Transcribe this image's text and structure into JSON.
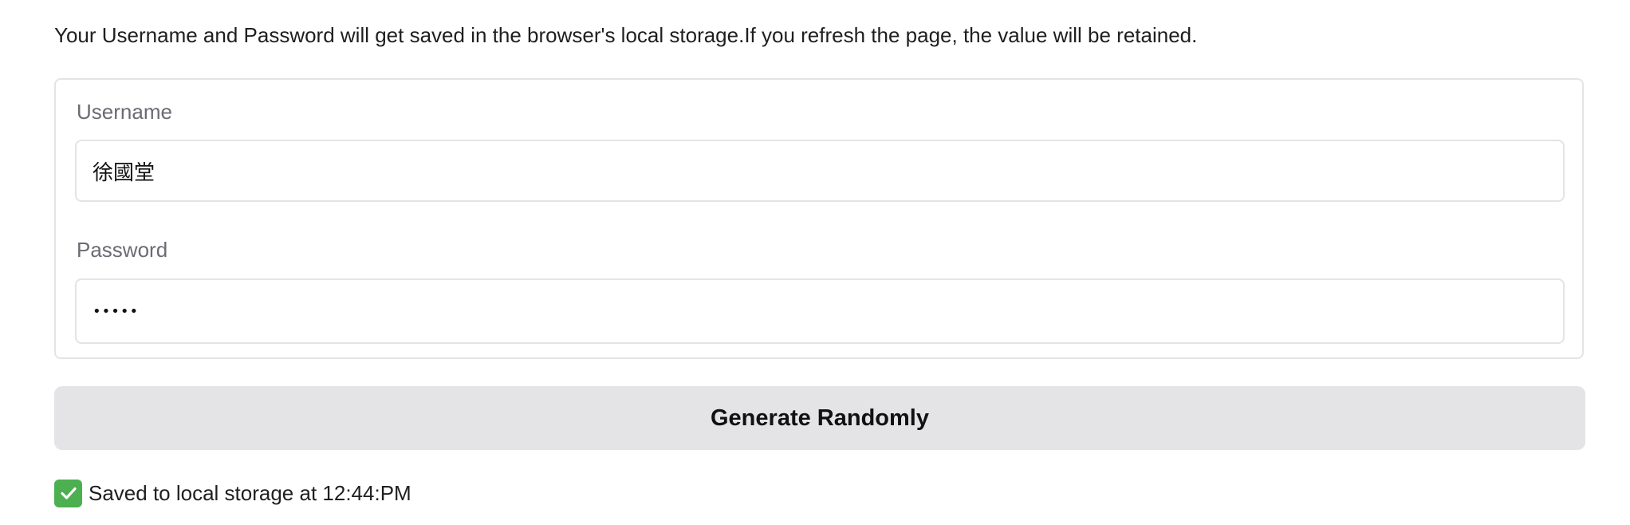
{
  "intro_text": "Your Username and Password will get saved in the browser's local storage.If you refresh the page, the value will be retained.",
  "form": {
    "username": {
      "label": "Username",
      "value": "徐國堂"
    },
    "password": {
      "label": "Password",
      "value": "•••••"
    }
  },
  "generate_button": {
    "label": "Generate Randomly"
  },
  "status": {
    "icon": "check-mark-icon",
    "text": "Saved to local storage at 12:44:PM",
    "icon_color": "#4caf50"
  },
  "colors": {
    "button_bg": "#e4e4e7",
    "border": "#e4e4e7",
    "label_gray": "#6b6b73"
  }
}
